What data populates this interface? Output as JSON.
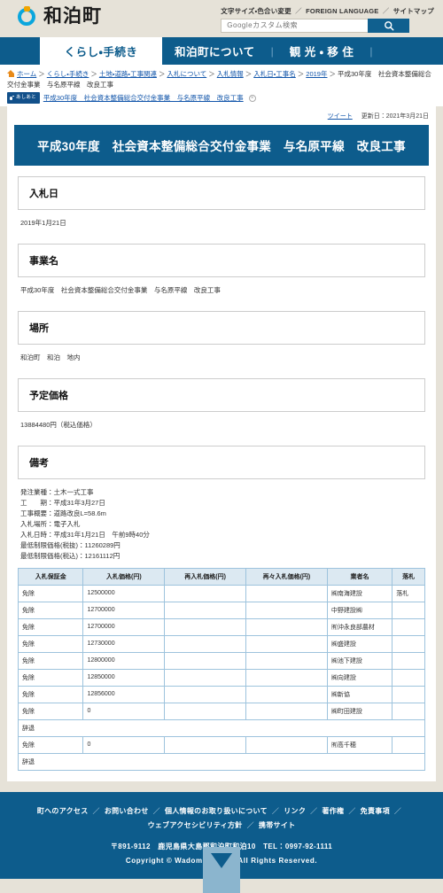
{
  "header": {
    "site_title": "和泊町",
    "util_links": [
      "文字サイズ・色合い変更",
      "FOREIGN LANGUAGE",
      "サイトマップ"
    ],
    "search_placeholder": "Googleカスタム検索",
    "search_value": ""
  },
  "nav": {
    "items": [
      {
        "label": "くらし・手続き",
        "active": true
      },
      {
        "label": "和泊町について",
        "active": false
      },
      {
        "label": "観 光 ・ 移 住",
        "active": false
      }
    ]
  },
  "breadcrumb": {
    "links": [
      "ホーム",
      "くらし・手続き",
      "土地・道路・工事関連",
      "入札について",
      "入札情報",
      "入札日・工事名",
      "2019年"
    ],
    "current": "平成30年度　社会資本整備総合交付金事業　与名原平線　改良工事",
    "separator": "＞"
  },
  "history": {
    "badge_label": "あしあと",
    "link_label": "平成30年度　社会資本整備総合交付金事業　与名原平線　改良工事",
    "close_label": "×"
  },
  "meta": {
    "tweet_label": "ツイート",
    "updated_label": "更新日：2021年3月21日"
  },
  "page": {
    "title": "平成30年度　社会資本整備総合交付金事業　与名原平線　改良工事"
  },
  "sections": [
    {
      "heading": "入札日",
      "text": "2019年1月21日"
    },
    {
      "heading": "事業名",
      "text": "平成30年度　社会資本整備総合交付金事業　与名原平線　改良工事"
    },
    {
      "heading": "場所",
      "text": "和泊町　和泊　地内"
    },
    {
      "heading": "予定価格",
      "text": "13884480円（税込価格）"
    }
  ],
  "remarks": {
    "heading": "備考",
    "lines": [
      "発注業種：土木一式工事",
      "工　　期：平成31年3月27日",
      "工事概要：道路改良L=58.6m",
      "入札場所：電子入札",
      "入札日時：平成31年1月21日　午前9時40分",
      "最低制限価格(税抜)：11260289円",
      "最低制限価格(税込)：12161112円"
    ]
  },
  "table": {
    "headers": [
      "入札保証金",
      "入札価格(円)",
      "再入札価格(円)",
      "再々入札価格(円)",
      "業者名",
      "落札"
    ],
    "rows": [
      {
        "type": "normal",
        "cells": [
          "免除",
          "12500000",
          "",
          "",
          "㈱南海建設",
          "落札"
        ]
      },
      {
        "type": "normal",
        "cells": [
          "免除",
          "12700000",
          "",
          "",
          "中野建設㈱",
          ""
        ]
      },
      {
        "type": "normal",
        "cells": [
          "免除",
          "12700000",
          "",
          "",
          "㈲沖永良部農材",
          ""
        ]
      },
      {
        "type": "normal",
        "cells": [
          "免除",
          "12730000",
          "",
          "",
          "㈱盛建設",
          ""
        ]
      },
      {
        "type": "normal",
        "cells": [
          "免除",
          "12800000",
          "",
          "",
          "㈱池下建設",
          ""
        ]
      },
      {
        "type": "normal",
        "cells": [
          "免除",
          "12850000",
          "",
          "",
          "㈱向建設",
          ""
        ]
      },
      {
        "type": "normal",
        "cells": [
          "免除",
          "12856000",
          "",
          "",
          "㈱新協",
          ""
        ]
      },
      {
        "type": "normal",
        "cells": [
          "免除",
          "0",
          "",
          "",
          "㈱町田建設",
          ""
        ]
      },
      {
        "type": "full",
        "cells": [
          "辞退"
        ]
      },
      {
        "type": "normal",
        "cells": [
          "免除",
          "0",
          "",
          "",
          "㈲高千穂",
          ""
        ]
      },
      {
        "type": "full",
        "cells": [
          "辞退"
        ]
      }
    ]
  },
  "footer": {
    "links_row1": [
      "町へのアクセス",
      "お問い合わせ",
      "個人情報のお取り扱いについて",
      "リンク",
      "著作権",
      "免責事項"
    ],
    "links_row2": [
      "ウェブアクセシビリティ方針",
      "携帯サイト"
    ],
    "address": "〒891-9112　鹿児島県大島郡和泊町和泊10　TEL：0997-92-1111",
    "copyright": "Copyright © Wadomari Town All Rights Reserved.",
    "separator": "／"
  },
  "colors": {
    "brand_blue": "#0d5c8c",
    "page_bg": "#e6e2d8",
    "table_header_bg": "#dce9f2",
    "link": "#1155aa",
    "logo_cyan": "#0aa6dd",
    "logo_orange": "#f0a500"
  }
}
